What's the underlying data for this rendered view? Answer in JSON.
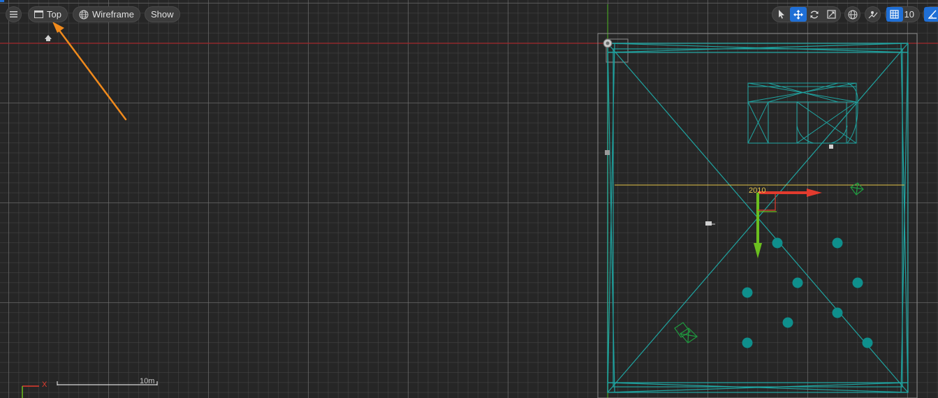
{
  "toolbar": {
    "menu_icon": "hamburger-icon",
    "view_mode_label": "Top",
    "view_mode_icon": "viewport-window-icon",
    "render_mode_label": "Wireframe",
    "render_mode_icon": "globe-wireframe-icon",
    "show_label": "Show",
    "right_tools": {
      "select_icon": "select-cursor-icon",
      "translate_icon": "translate-move-icon",
      "rotate_icon": "rotate-icon",
      "scale_icon": "scale-icon",
      "world_space_icon": "globe-world-space-icon",
      "surface_snap_icon": "surface-snap-icon",
      "grid_snap_icon": "grid-snap-icon",
      "grid_snap_value": "10",
      "angle_snap_icon": "angle-snap-icon"
    }
  },
  "viewport": {
    "selected_actor_label": "2010",
    "scale_bar_label": "10m",
    "axis_x_label": "X",
    "colors": {
      "background": "#262626",
      "wireframe": "#1fa3a0",
      "x_axis": "#e23b2e",
      "y_axis": "#6bbf1f",
      "selection_line": "#e6c64a",
      "annotation_arrow": "#f08a1c"
    }
  }
}
